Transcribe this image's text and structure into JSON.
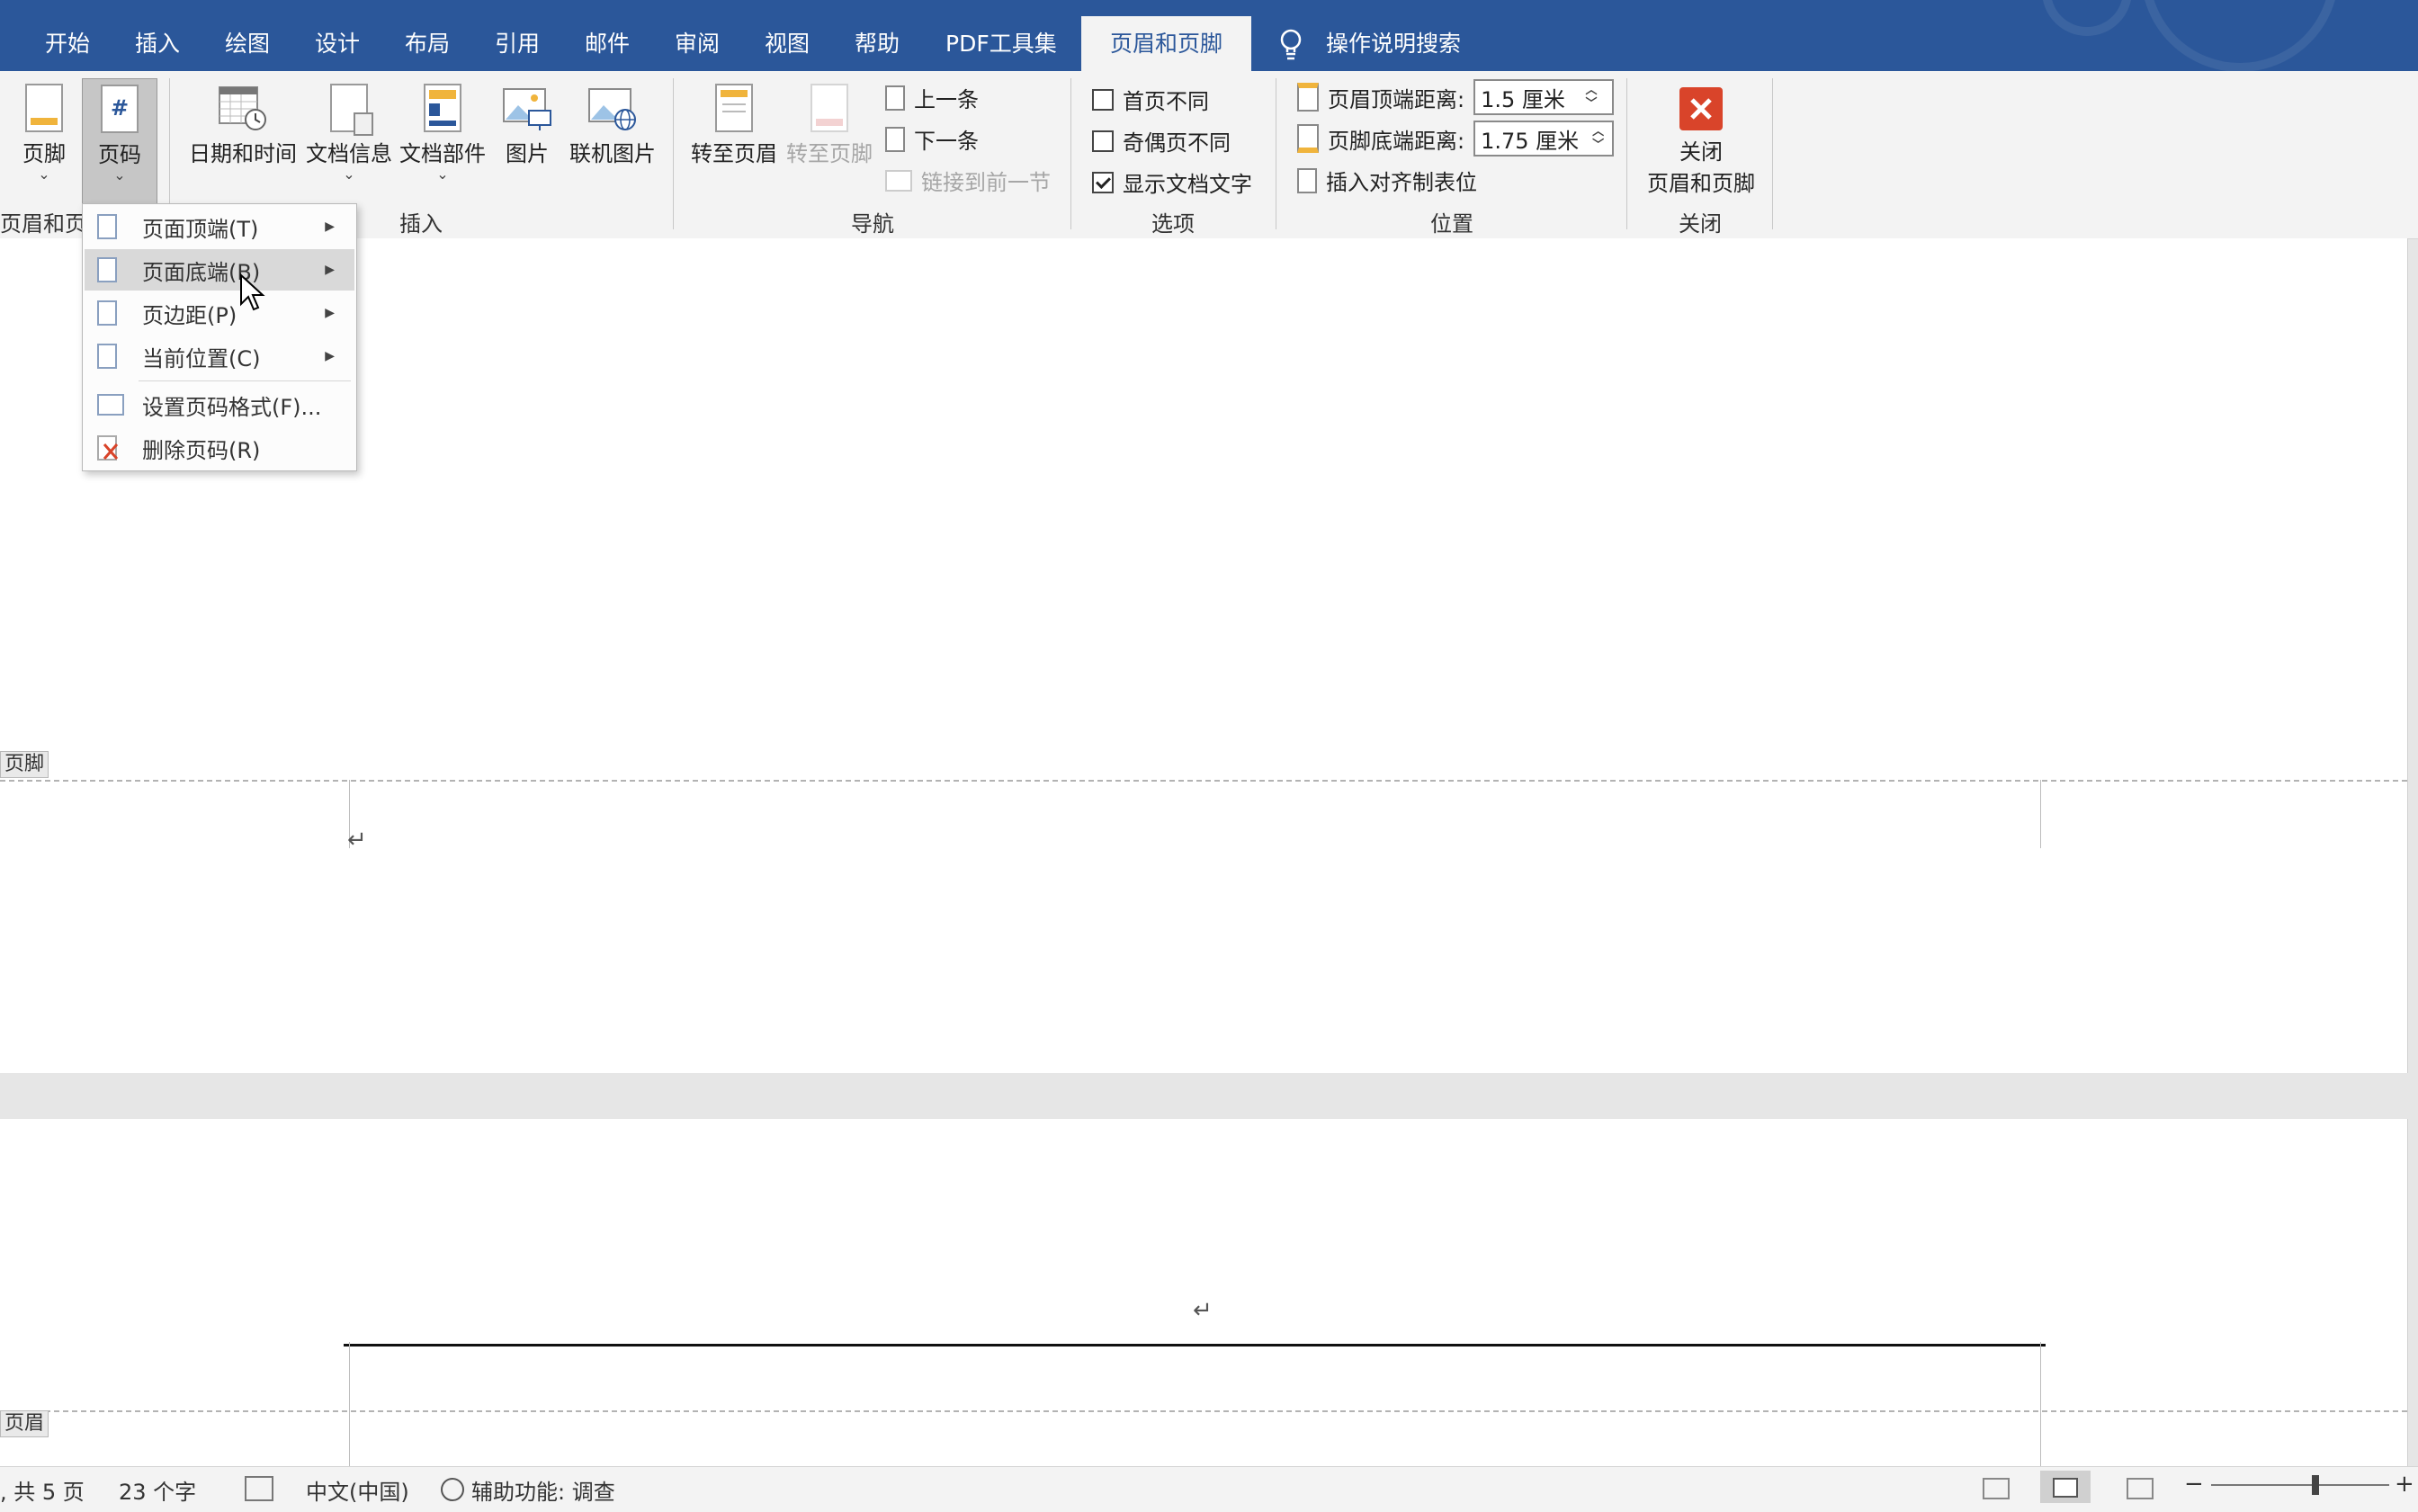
{
  "menubar": {
    "tabs": [
      {
        "label": "开始"
      },
      {
        "label": "插入"
      },
      {
        "label": "绘图"
      },
      {
        "label": "设计"
      },
      {
        "label": "布局"
      },
      {
        "label": "引用"
      },
      {
        "label": "邮件"
      },
      {
        "label": "审阅"
      },
      {
        "label": "视图"
      },
      {
        "label": "帮助"
      },
      {
        "label": "PDF工具集"
      },
      {
        "label": "页眉和页脚"
      }
    ],
    "active_tab": "页眉和页脚",
    "search_label": "操作说明搜索",
    "search_icon": "lightbulb-icon",
    "accent_color": "#2b579a"
  },
  "ribbon": {
    "footer_btn": "页脚",
    "pagenum_btn": "页码",
    "group_hf_label": "页眉和页脚",
    "insert": {
      "datetime": "日期和时间",
      "docinfo": "文档信息",
      "quickparts": "文档部件",
      "picture": "图片",
      "online_picture": "联机图片",
      "group_label": "插入"
    },
    "nav": {
      "goto_header": "转至页眉",
      "goto_footer": "转至页脚",
      "prev": "上一条",
      "next": "下一条",
      "link_prev": "链接到前一节",
      "group_label": "导航"
    },
    "options": {
      "first_page": "首页不同",
      "first_page_checked": false,
      "odd_even": "奇偶页不同",
      "odd_even_checked": false,
      "show_doc_text": "显示文档文字",
      "show_doc_text_checked": true,
      "group_label": "选项"
    },
    "position": {
      "header_dist_label": "页眉顶端距离:",
      "header_dist_value": "1.5 厘米",
      "footer_dist_label": "页脚底端距离:",
      "footer_dist_value": "1.75 厘米",
      "insert_align_tab": "插入对齐制表位",
      "group_label": "位置"
    },
    "close": {
      "label_line1": "关闭",
      "label_line2": "页眉和页脚",
      "group_label": "关闭",
      "icon_color": "#d9442a"
    }
  },
  "dropdown": {
    "items": [
      {
        "label": "页面顶端(T)",
        "submenu": true
      },
      {
        "label": "页面底端(B)",
        "submenu": true,
        "highlighted": true
      },
      {
        "label": "页边距(P)",
        "submenu": true
      },
      {
        "label": "当前位置(C)",
        "submenu": true
      },
      {
        "label": "设置页码格式(F)...",
        "submenu": false
      },
      {
        "label": "删除页码(R)",
        "submenu": false
      }
    ]
  },
  "document": {
    "footer_tag": "页脚",
    "header_tag": "页眉",
    "para_mark": "↵"
  },
  "statusbar": {
    "pages": ", 共 5 页",
    "words": "23 个字",
    "language": "中文(中国)",
    "accessibility": "辅助功能: 调查",
    "zoom_minus": "−",
    "zoom_plus": "+"
  }
}
